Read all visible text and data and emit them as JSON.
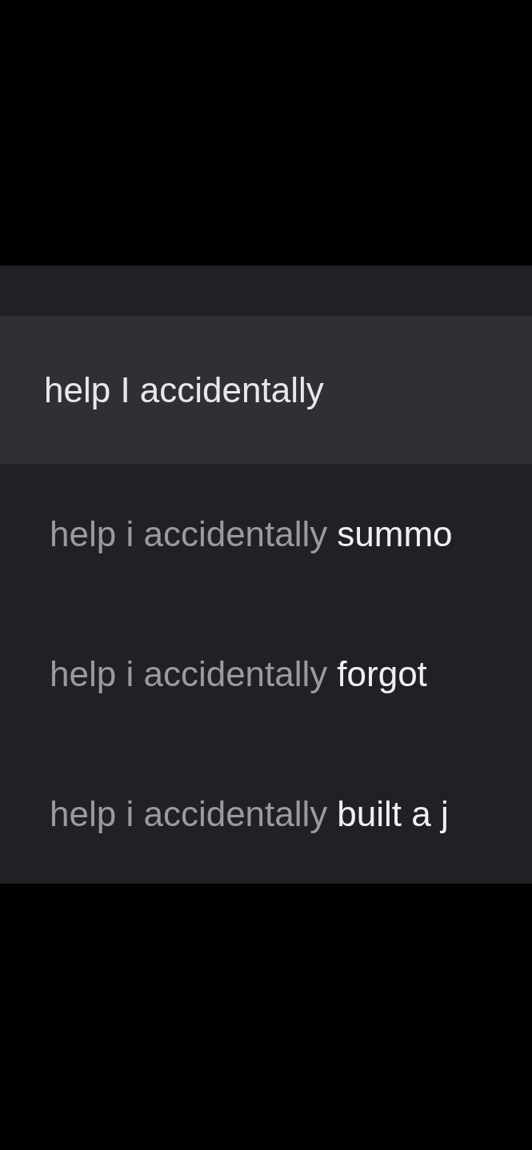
{
  "search": {
    "value": "help I accidentally"
  },
  "suggestions": [
    {
      "prefix": "help i accidentally",
      "completion": "summo"
    },
    {
      "prefix": "help i accidentally",
      "completion": "forgot"
    },
    {
      "prefix": "help i accidentally",
      "completion": "built a j"
    }
  ]
}
